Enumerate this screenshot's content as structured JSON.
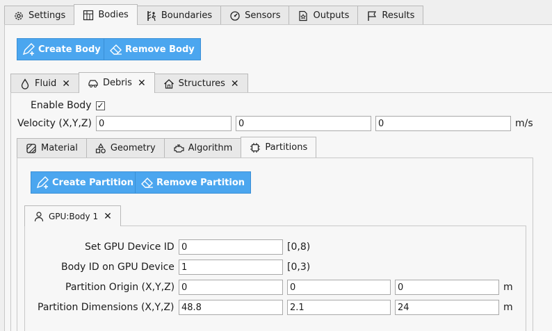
{
  "main_tabs": [
    {
      "label": "Settings",
      "icon": "gear-icon"
    },
    {
      "label": "Bodies",
      "icon": "grid-icon"
    },
    {
      "label": "Boundaries",
      "icon": "boundary-icon"
    },
    {
      "label": "Sensors",
      "icon": "gauge-icon"
    },
    {
      "label": "Outputs",
      "icon": "export-icon"
    },
    {
      "label": "Results",
      "icon": "flag-icon"
    }
  ],
  "body_actions": {
    "create": "Create Body",
    "remove": "Remove Body"
  },
  "body_tabs": [
    {
      "label": "Fluid",
      "icon": "drop-icon"
    },
    {
      "label": "Debris",
      "icon": "car-icon"
    },
    {
      "label": "Structures",
      "icon": "house-icon"
    }
  ],
  "enable_body": {
    "label": "Enable Body",
    "checked": true
  },
  "velocity": {
    "label": "Velocity (X,Y,Z)",
    "values": [
      "0",
      "0",
      "0"
    ],
    "unit": "m/s"
  },
  "sub_tabs": [
    {
      "label": "Material",
      "icon": "material-icon"
    },
    {
      "label": "Geometry",
      "icon": "shapes-icon"
    },
    {
      "label": "Algorithm",
      "icon": "engine-icon"
    },
    {
      "label": "Partitions",
      "icon": "chip-icon"
    }
  ],
  "partition_actions": {
    "create": "Create Partition",
    "remove": "Remove Partition"
  },
  "partition_tab": {
    "label": "GPU:Body 1",
    "icon": "user-icon"
  },
  "fields": {
    "gpu_device": {
      "label": "Set GPU Device ID",
      "value": "0",
      "range": "[0,8)"
    },
    "body_id": {
      "label": "Body ID on GPU Device",
      "value": "1",
      "range": "[0,3)"
    },
    "origin": {
      "label": "Partition Origin (X,Y,Z)",
      "values": [
        "0",
        "0",
        "0"
      ],
      "unit": "m"
    },
    "dimensions": {
      "label": "Partition Dimensions (X,Y,Z)",
      "values": [
        "48.8",
        "2.1",
        "24"
      ],
      "unit": "m"
    }
  }
}
